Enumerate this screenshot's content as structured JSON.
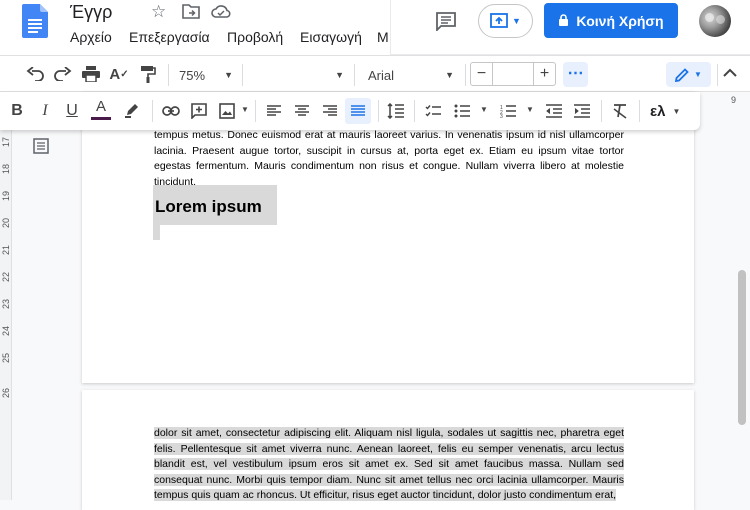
{
  "app": {
    "doc_title": "Έγγρ",
    "share_label": "Κοινή Χρήση",
    "colors": {
      "docs_blue": "#4285f4",
      "share_button": "#1a73e8",
      "highlight": "#d9d9d9"
    }
  },
  "menu": {
    "items": [
      "Αρχείο",
      "Επεξεργασία",
      "Προβολή",
      "Εισαγωγή",
      "Μ"
    ]
  },
  "toolbar": {
    "zoom": "75%",
    "font": "Arial",
    "minus": "−",
    "plus": "+",
    "more": "⋯",
    "lang": "ελ"
  },
  "ruler": {
    "numbers": [
      "17",
      "18",
      "19",
      "20",
      "21",
      "22",
      "23",
      "24",
      "25",
      "26"
    ],
    "top_mark": "9"
  },
  "document": {
    "page1_text": "tempus metus. Donec euismod erat at mauris laoreet varius. In venenatis ipsum id nisl ullamcorper lacinia. Praesent augue tortor, suscipit in cursus at, porta eget ex. Etiam eu ipsum vitae tortor egestas fermentum. Mauris condimentum non risus et congue. Nullam viverra libero at molestie tincidunt.",
    "heading": "Lorem ipsum",
    "page2_text": "dolor sit amet, consectetur adipiscing elit. Aliquam nisl ligula, sodales ut sagittis nec, pharetra eget felis. Pellentesque sit amet viverra nunc. Aenean laoreet, felis eu semper venenatis, arcu lectus blandit est, vel vestibulum ipsum eros sit amet ex. Sed sit amet faucibus massa. Nullam sed consequat nunc. Morbi quis tempor diam. Nunc sit amet tellus nec orci lacinia ullamcorper. Mauris tempus quis quam ac rhoncus. Ut efficitur, risus eget auctor tincidunt, dolor justo condimentum erat,"
  }
}
